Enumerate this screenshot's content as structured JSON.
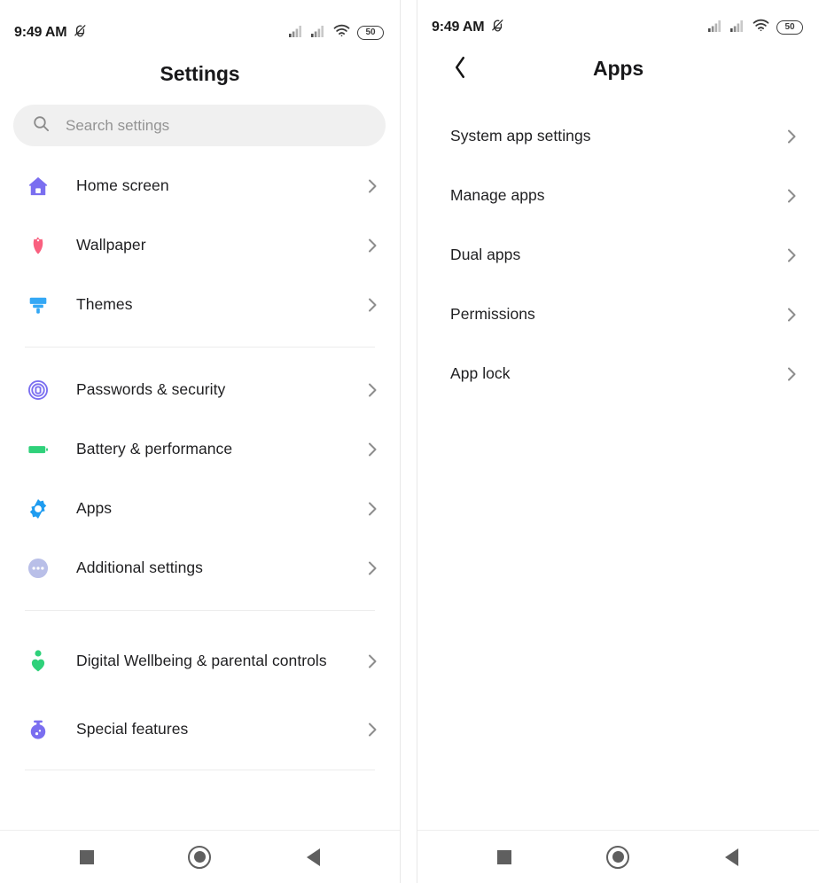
{
  "statusbar": {
    "time": "9:49 AM",
    "mute_icon": "bell-muted-icon",
    "signal1_icon": "signal-bars-icon",
    "signal2_icon": "signal-bars-icon",
    "wifi_icon": "wifi-icon",
    "battery_level": "50"
  },
  "left_screen": {
    "title": "Settings",
    "search": {
      "icon": "search-icon",
      "placeholder": "Search settings",
      "value": ""
    },
    "groups": [
      {
        "items": [
          {
            "label": "Home screen",
            "icon": "home-icon",
            "color": "#7a6ef0",
            "chevron": "chevron-right-icon"
          },
          {
            "label": "Wallpaper",
            "icon": "flower-icon",
            "color": "#f9607f",
            "chevron": "chevron-right-icon"
          },
          {
            "label": "Themes",
            "icon": "paintbrush-icon",
            "color": "#34a8f5",
            "chevron": "chevron-right-icon"
          }
        ]
      },
      {
        "items": [
          {
            "label": "Passwords & security",
            "icon": "fingerprint-icon",
            "color": "#7a6ef0",
            "chevron": "chevron-right-icon"
          },
          {
            "label": "Battery & performance",
            "icon": "battery-icon",
            "color": "#2fd17a",
            "chevron": "chevron-right-icon"
          },
          {
            "label": "Apps",
            "icon": "gear-icon",
            "color": "#1f9cf0",
            "chevron": "chevron-right-icon"
          },
          {
            "label": "Additional settings",
            "icon": "more-horizontal-icon",
            "color": "#b9bfe8",
            "chevron": "chevron-right-icon"
          }
        ]
      },
      {
        "items": [
          {
            "label": "Digital Wellbeing & parental controls",
            "icon": "person-heart-icon",
            "color": "#2fd17a",
            "chevron": "chevron-right-icon"
          },
          {
            "label": "Special features",
            "icon": "flask-icon",
            "color": "#7a6ef0",
            "chevron": "chevron-right-icon"
          }
        ]
      }
    ]
  },
  "right_screen": {
    "title": "Apps",
    "back_icon": "chevron-left-icon",
    "items": [
      {
        "label": "System app settings",
        "chevron": "chevron-right-icon"
      },
      {
        "label": "Manage apps",
        "chevron": "chevron-right-icon"
      },
      {
        "label": "Dual apps",
        "chevron": "chevron-right-icon"
      },
      {
        "label": "Permissions",
        "chevron": "chevron-right-icon"
      },
      {
        "label": "App lock",
        "chevron": "chevron-right-icon"
      }
    ]
  },
  "navbar": {
    "recents_icon": "square-recents-icon",
    "home_icon": "circle-home-icon",
    "back_icon": "triangle-back-icon"
  }
}
